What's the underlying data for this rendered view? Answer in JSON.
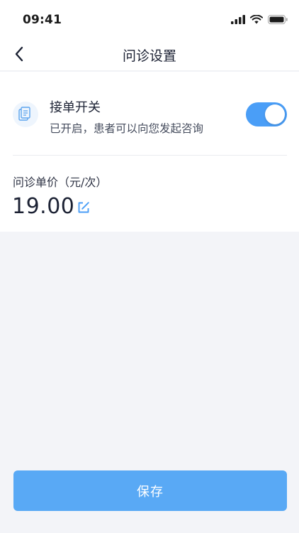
{
  "status_bar": {
    "time": "09:41",
    "icons": [
      "cellular-signal-icon",
      "wifi-icon",
      "battery-icon"
    ]
  },
  "nav": {
    "back_icon": "chevron-left-icon",
    "title": "问诊设置"
  },
  "order_toggle": {
    "icon": "document-icon",
    "title": "接单开关",
    "description": "已开启，患者可以向您发起咨询",
    "enabled": true,
    "accent_color": "#4a9ef7"
  },
  "price": {
    "label": "问诊单价（元/次）",
    "value": "19.00",
    "edit_icon": "edit-icon"
  },
  "footer": {
    "save_label": "保存",
    "save_color": "#59a9f5"
  }
}
